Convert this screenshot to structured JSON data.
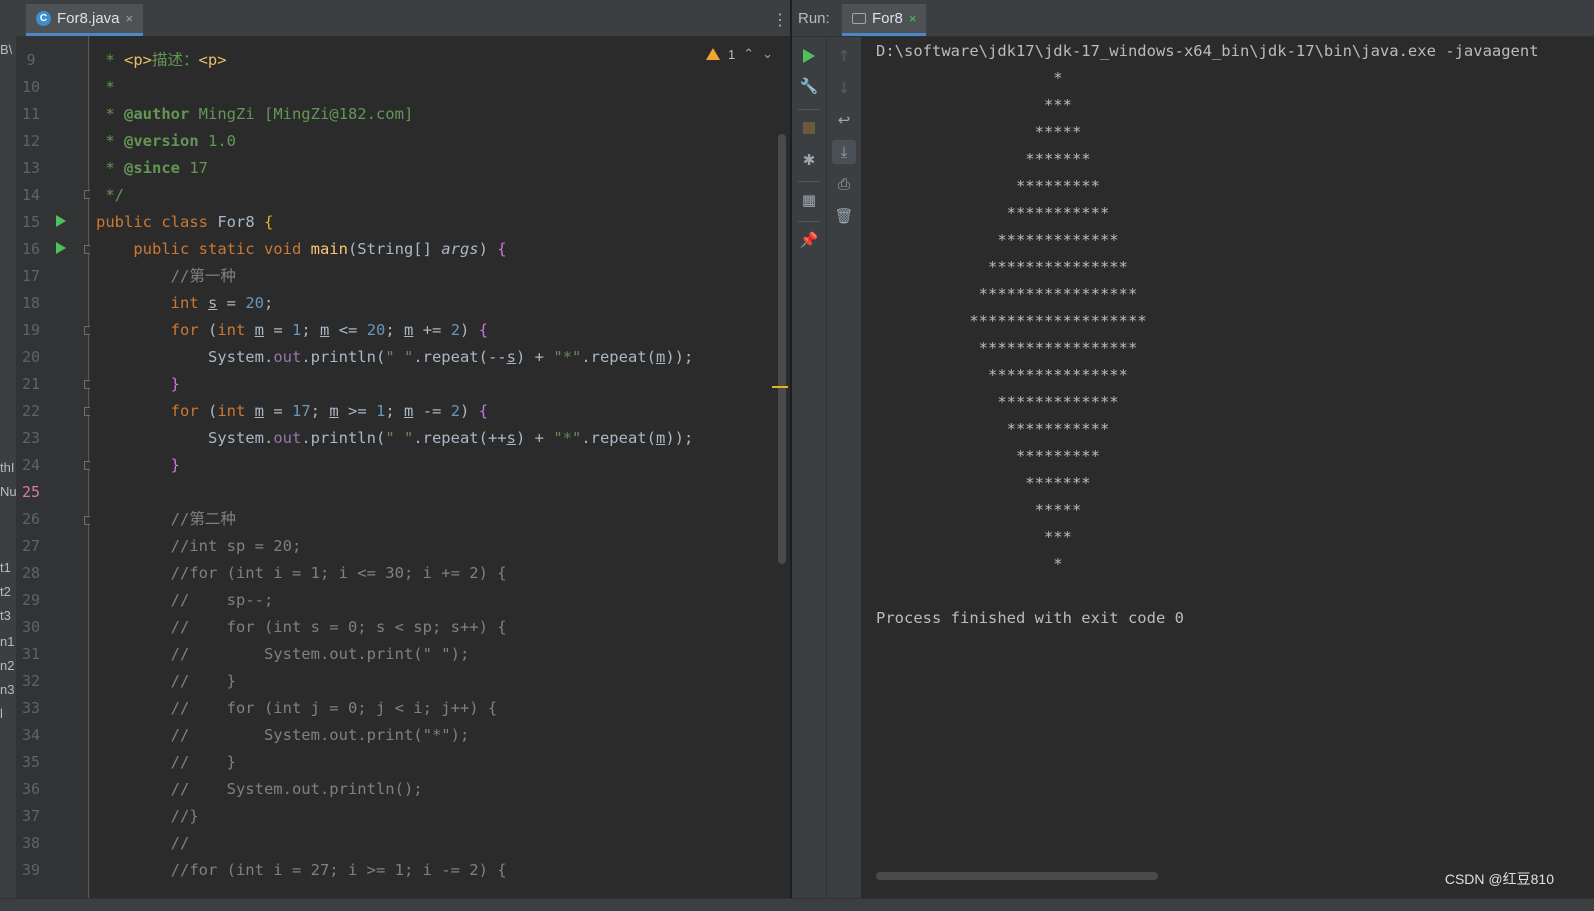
{
  "editor": {
    "tab_label": "For8.java",
    "tab_close": "×",
    "more_icon": "⋮",
    "inspection_count": "1",
    "current_line": 25,
    "line_numbers": [
      "9",
      "10",
      "11",
      "12",
      "13",
      "14",
      "15",
      "16",
      "17",
      "18",
      "19",
      "20",
      "21",
      "22",
      "23",
      "24",
      "25",
      "26",
      "27",
      "28",
      "29",
      "30",
      "31",
      "32",
      "33",
      "34",
      "35",
      "36",
      "37",
      "38",
      "39"
    ],
    "left_fragments": [
      "B\\",
      "thI",
      "Nu",
      "t1",
      "t2",
      "t3",
      "n1",
      "n2",
      "n3",
      "l"
    ]
  },
  "run": {
    "label": "Run:",
    "tab_label": "For8",
    "tab_close": "×",
    "console_lines": [
      "D:\\software\\jdk17\\jdk-17_windows-x64_bin\\jdk-17\\bin\\java.exe -javaagent",
      "                   *",
      "                  ***",
      "                 *****",
      "                *******",
      "               *********",
      "              ***********",
      "             *************",
      "            ***************",
      "           *****************",
      "          *******************",
      "           *****************",
      "            ***************",
      "             *************",
      "              ***********",
      "               *********",
      "                *******",
      "                 *****",
      "                  ***",
      "                   *",
      "",
      "Process finished with exit code 0"
    ]
  },
  "watermark": "CSDN @红豆810",
  "colors": {
    "background": "#2b2b2b",
    "keyword": "#cc7832",
    "string": "#6a8759",
    "number": "#6897bb",
    "comment": "#808080",
    "run_green": "#4ec25a"
  }
}
